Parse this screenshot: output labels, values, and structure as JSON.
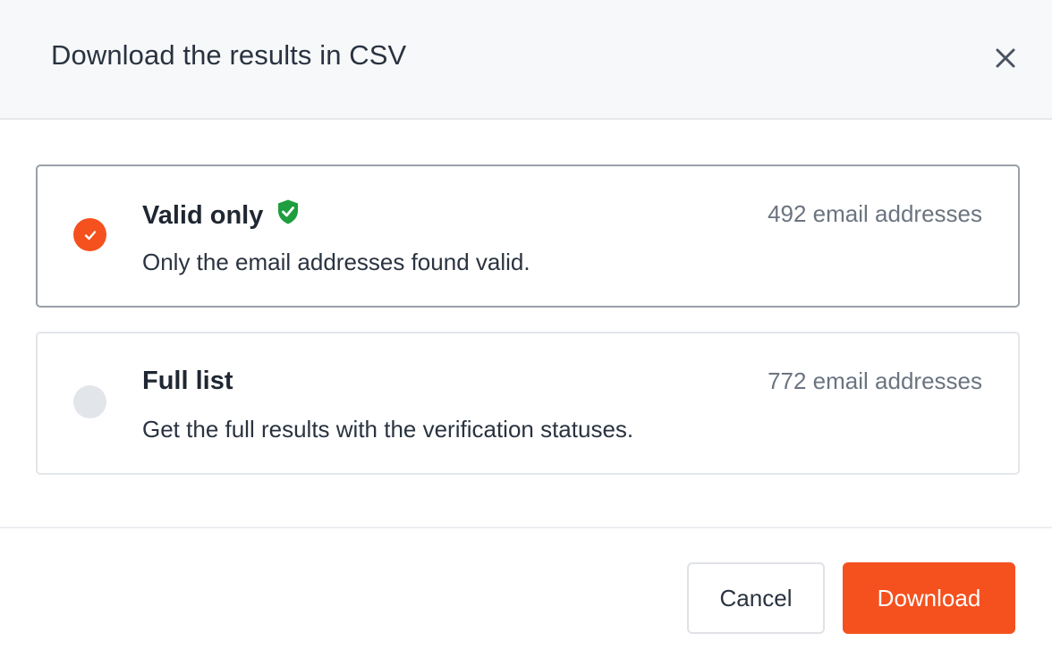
{
  "dialog": {
    "title": "Download the results in CSV",
    "close_icon": "close-icon"
  },
  "options": [
    {
      "title": "Valid only",
      "badge_icon": "shield-check-icon",
      "description": "Only the email addresses found valid.",
      "count": "492 email addresses",
      "selected": true
    },
    {
      "title": "Full list",
      "description": "Get the full results with the verification statuses.",
      "count": "772 email addresses",
      "selected": false
    }
  ],
  "footer": {
    "cancel_label": "Cancel",
    "download_label": "Download"
  },
  "colors": {
    "accent": "#f4511e",
    "shield": "#1e9e3e",
    "header_bg": "#f7f8fa",
    "radio_off": "#e2e5ea"
  }
}
